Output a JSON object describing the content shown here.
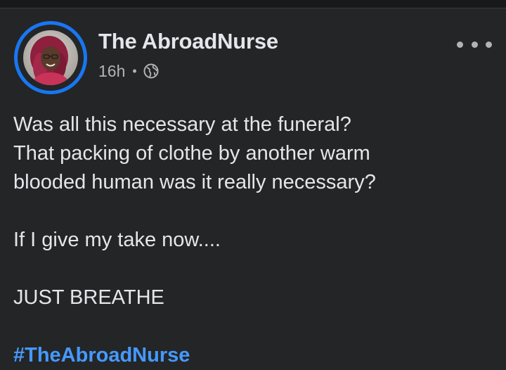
{
  "post": {
    "author": "The AbroadNurse",
    "timestamp": "16h",
    "separator": "•",
    "audience_icon": "globe-icon",
    "more_icon": "more-options-icon",
    "avatar_ring_color": "#1877f2",
    "text_lines": [
      "Was all this necessary at the funeral?",
      "That packing of clothe by another warm",
      "blooded human was it really necessary?"
    ],
    "paragraph2": "If I give my take now....",
    "paragraph3": "JUST BREATHE",
    "hashtag": "#TheAbroadNurse",
    "hashtag_color": "#4599ff"
  }
}
